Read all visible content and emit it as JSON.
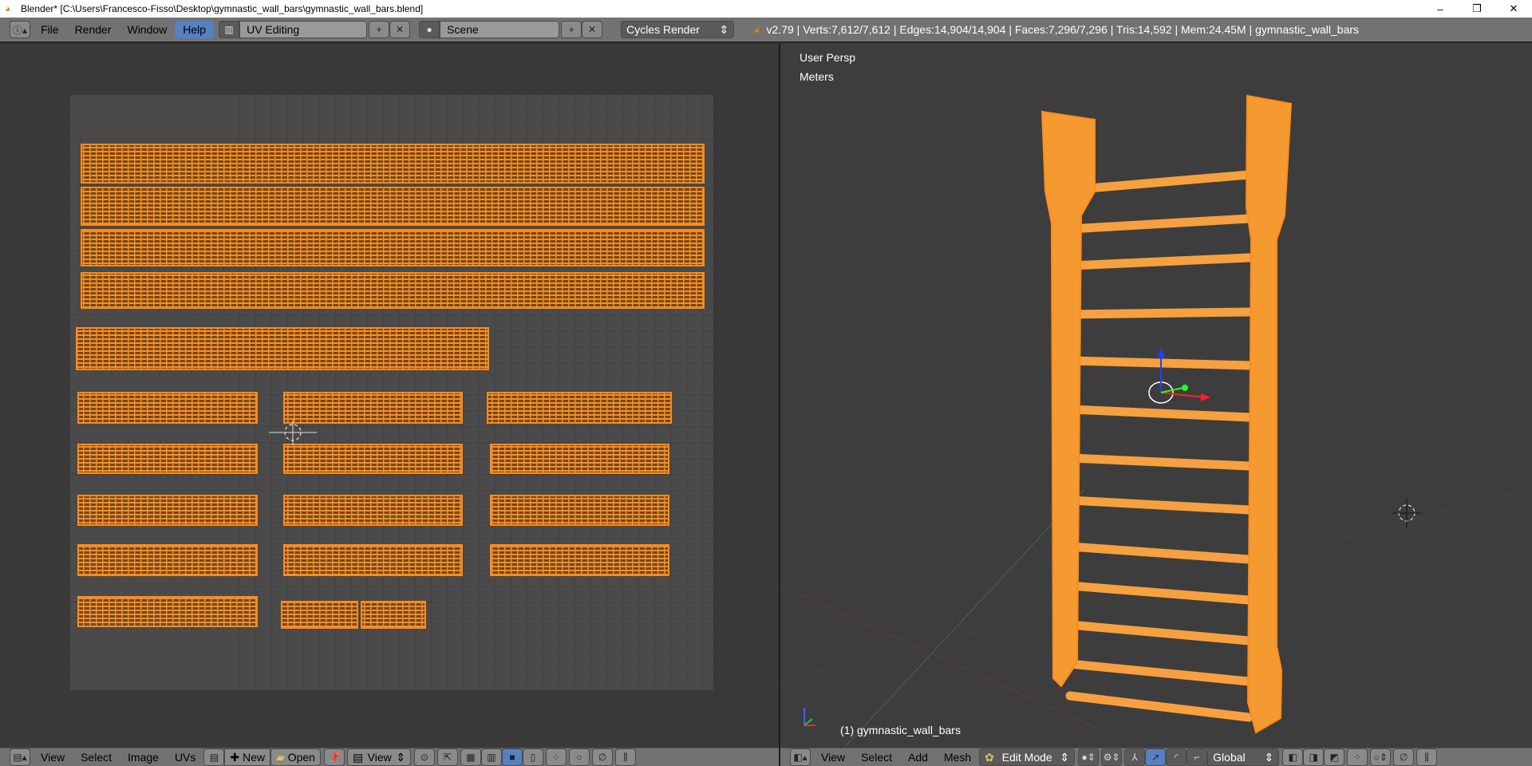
{
  "window": {
    "title": "Blender* [C:\\Users\\Francesco-Fisso\\Desktop\\gymnastic_wall_bars\\gymnastic_wall_bars.blend]",
    "minimize": "–",
    "maximize": "❐",
    "close": "✕"
  },
  "top_header": {
    "menus": [
      "File",
      "Render",
      "Window",
      "Help"
    ],
    "active_menu": "Help",
    "screen_layout": "UV Editing",
    "scene": "Scene",
    "render_engine": "Cycles Render",
    "stats": "v2.79 | Verts:7,612/7,612 | Edges:14,904/14,904 | Faces:7,296/7,296 | Tris:14,592 | Mem:24.45M | gymnastic_wall_bars"
  },
  "uv_editor": {
    "menus": [
      "View",
      "Select",
      "Image",
      "UVs"
    ],
    "new_label": "New",
    "open_label": "Open",
    "view_label": "View"
  },
  "viewport": {
    "view_label": "User Persp",
    "units_label": "Meters",
    "object_label": "(1) gymnastic_wall_bars",
    "menus": [
      "View",
      "Select",
      "Add",
      "Mesh"
    ],
    "mode": "Edit Mode",
    "orientation": "Global"
  },
  "colors": {
    "accent": "#5680c2",
    "selection": "#ff8c1a",
    "header": "#727272",
    "background": "#393939"
  }
}
